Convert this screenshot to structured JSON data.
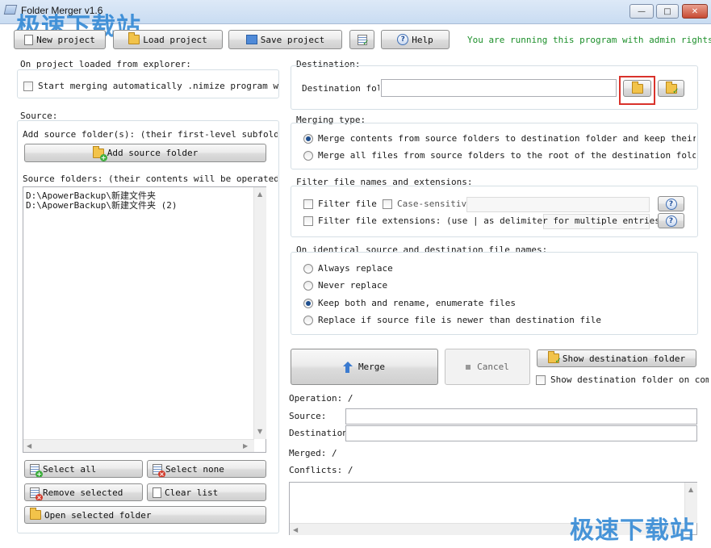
{
  "window": {
    "title": "Folder Merger v1.6",
    "watermark": "极速下载站",
    "buttons": {
      "minimize": "—",
      "maximize": "□",
      "close": "✕"
    }
  },
  "toolbar": {
    "new_project": "New project",
    "load_project": "Load project",
    "save_project": "Save project",
    "help": "Help",
    "admin_notice": "You are running this program with admin rights."
  },
  "project_loaded": {
    "label": "On project loaded from explorer:",
    "auto_merge": "Start merging automatically .nimize program window"
  },
  "source": {
    "label": "Source:",
    "add_hint": "Add source folder(s): (their first-level subfolders w",
    "add_button": "Add source folder",
    "folders_label": "Source folders: (their contents will be operated on)",
    "folders": [
      "D:\\ApowerBackup\\新建文件夹",
      "D:\\ApowerBackup\\新建文件夹 (2)"
    ],
    "select_all": "Select all",
    "select_none": "Select none",
    "remove_selected": "Remove selected",
    "clear_list": "Clear list",
    "open_selected": "Open selected folder"
  },
  "destination": {
    "label": "Destination:",
    "field_label": "Destination fold",
    "value": ""
  },
  "merging_type": {
    "label": "Merging type:",
    "options": [
      {
        "label": "Merge contents from source folders to destination folder and keep their folder",
        "selected": true
      },
      {
        "label": "Merge all files from source folders to the root of the destination folder",
        "selected": false
      }
    ]
  },
  "filter": {
    "label": "Filter file names and extensions:",
    "file_names": "Filter file n",
    "case_sensitive": "Case-sensitive",
    "extensions": "Filter file extensions: (use | as delimiter for multiple entries)",
    "help_glyph": "?"
  },
  "identical": {
    "label": "On identical source and destination file names:",
    "options": [
      {
        "label": "Always replace",
        "selected": false
      },
      {
        "label": "Never replace",
        "selected": false
      },
      {
        "label": "Keep both and rename, enumerate files",
        "selected": true
      },
      {
        "label": "Replace if source file is newer than destination file",
        "selected": false
      }
    ]
  },
  "actions": {
    "merge": "Merge",
    "cancel": "Cancel",
    "show_destination": "Show destination folder",
    "show_on_complete": "Show destination folder on comple"
  },
  "status": {
    "operation": "Operation: /",
    "source": "Source:",
    "destination": "Destination:",
    "merged": "Merged: /",
    "conflicts": "Conflicts: /"
  }
}
